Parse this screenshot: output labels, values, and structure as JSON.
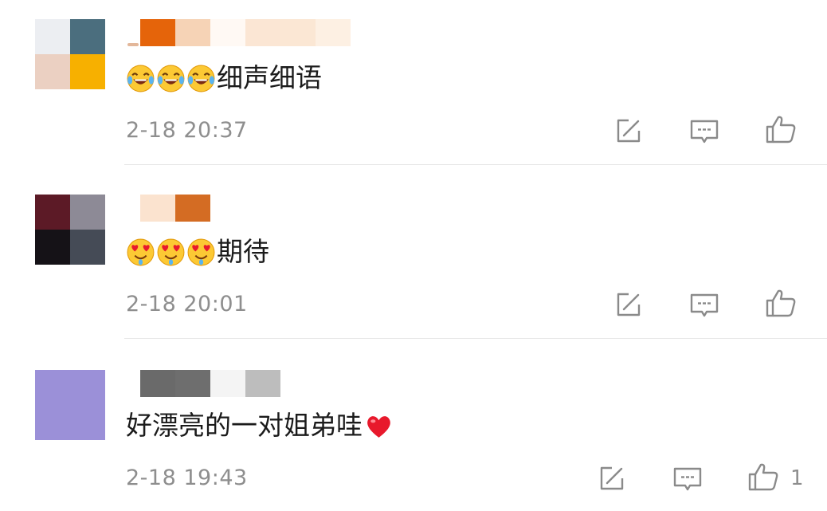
{
  "comments": [
    {
      "text": "细声细语",
      "emoji": [
        "laughing-tears-emoji",
        "laughing-tears-emoji",
        "laughing-tears-emoji"
      ],
      "time": "2-18 20:37",
      "like_count": ""
    },
    {
      "text": "期待",
      "emoji": [
        "heart-eyes-drool-emoji",
        "heart-eyes-drool-emoji",
        "heart-eyes-drool-emoji"
      ],
      "time": "2-18 20:01",
      "like_count": ""
    },
    {
      "text": "好漂亮的一对姐弟哇",
      "emoji_after": "red-heart-emoji",
      "time": "2-18 19:43",
      "like_count": "1"
    }
  ],
  "icons": {
    "share": "share-icon",
    "reply": "comment-icon",
    "like": "thumbs-up-icon"
  },
  "colors": {
    "text": "#1b1b1b",
    "meta": "#8e8e8e",
    "divider": "#e6e6e6",
    "heart": "#e8192c"
  }
}
